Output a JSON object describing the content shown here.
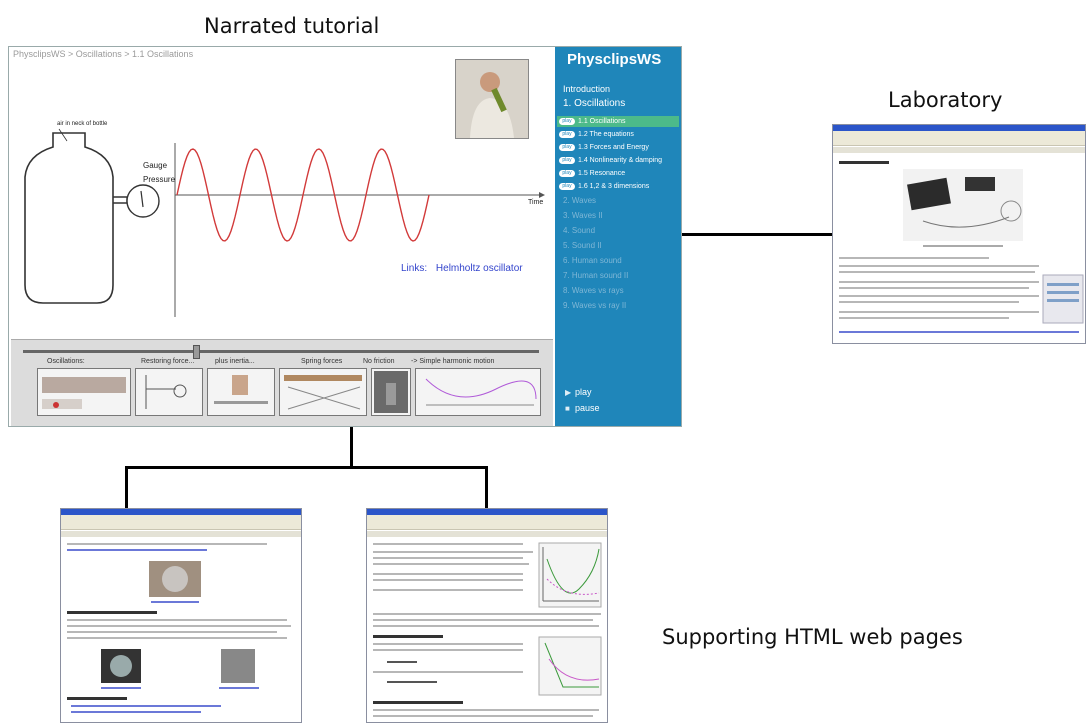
{
  "captions": {
    "narrated": "Narrated tutorial",
    "laboratory": "Laboratory",
    "supporting": "Supporting HTML web pages"
  },
  "tutorial": {
    "breadcrumb": "PhysclipsWS > Oscillations > 1.1 Oscillations",
    "air_label": "air in neck of bottle",
    "gauge_label_1": "Gauge",
    "gauge_label_2": "Pressure",
    "time_label": "Time",
    "links_label": "Links:",
    "links_value": "Helmholtz oscillator"
  },
  "sidebar": {
    "title": "PhysclipsWS",
    "intro": "Introduction",
    "section": "1. Oscillations",
    "badge": "play",
    "items": [
      "1.1 Oscillations",
      "1.2 The equations",
      "1.3 Forces and Energy",
      "1.4 Nonlinearity & damping",
      "1.5 Resonance",
      "1.6 1,2 & 3 dimensions"
    ],
    "chapters": [
      "2. Waves",
      "3. Waves II",
      "4. Sound",
      "5. Sound II",
      "6. Human sound",
      "7. Human sound II",
      "8. Waves vs rays",
      "9. Waves vs ray II"
    ],
    "play": "play",
    "pause": "pause"
  },
  "filmstrip": {
    "labels": [
      "Oscillations:",
      "Restoring force...",
      "plus inertia...",
      "Spring forces",
      "No friction",
      "-> Simple harmonic motion"
    ]
  },
  "colors": {
    "sidebar": "#1f86ba",
    "active_item": "#4cba8a",
    "wave": "#d23a3a",
    "link": "#3344cc"
  },
  "icons": {
    "play": "play-icon",
    "pause": "pause-icon"
  }
}
